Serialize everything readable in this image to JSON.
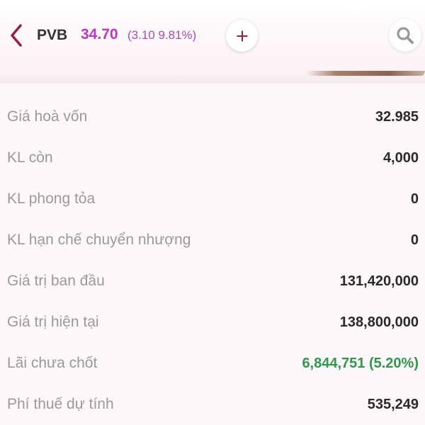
{
  "header": {
    "ticker": "PVB",
    "price": "34.70",
    "change": "(3.10 9.81%)",
    "icons": {
      "back": "chevron-left-icon",
      "add": "plus-icon",
      "search": "search-icon"
    },
    "colors": {
      "price": "#c234c8",
      "back": "#9a2036",
      "add": "#9a2036",
      "search": "#999999"
    }
  },
  "details": [
    {
      "label": "Giá hoà vốn",
      "value": "32.985"
    },
    {
      "label": "KL còn",
      "value": "4,000"
    },
    {
      "label": "KL phong tỏa",
      "value": "0"
    },
    {
      "label": "KL hạn chế chuyển nhượng",
      "value": "0"
    },
    {
      "label": "Giá trị ban đầu",
      "value": "131,420,000"
    },
    {
      "label": "Giá trị hiện tại",
      "value": "138,800,000"
    },
    {
      "label": "Lãi chưa chốt",
      "value": "6,844,751 (5.20%)",
      "color": "#2c9a4a"
    },
    {
      "label": "Phí thuế dự tính",
      "value": "535,249"
    }
  ]
}
